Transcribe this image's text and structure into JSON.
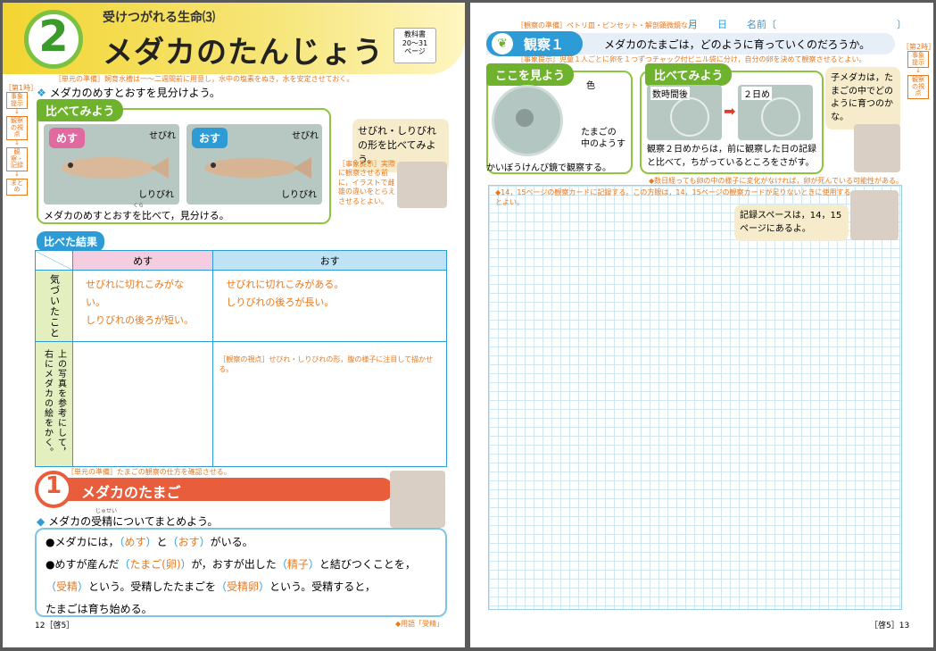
{
  "left": {
    "unit_number": "2",
    "unit_subtitle": "受けつがれる生命",
    "unit_subtitle_no": "⑶",
    "title": "メダカのたんじょう",
    "textbook_ref": "教科書\n20～31\nページ",
    "prep_note": "［単元の準備］飼育水槽は一～二週間前に用意し，水中の塩素をぬき，水を安定させておく。",
    "period_tag": "［第1時］",
    "side_steps": [
      "事象提示",
      "観察の視点",
      "観察・記録",
      "まとめ"
    ],
    "task": "メダカのめすとおすを見分けよう。",
    "compare_tag": "比べてみよう",
    "mesu": "めす",
    "osu": "おす",
    "sebire": "せびれ",
    "shiribire": "しりびれ",
    "compare_caption": "メダカのめすとおすを比べて，見分ける。",
    "caption_ruby": "くら",
    "bubble": "せびれ・しりびれの形を比べてみよう。",
    "event_note": "［事象提示］実際に観察させる前に，イラストで雌雄の違いをとらえさせるとよい。",
    "result_tag": "比べた結果",
    "table": {
      "col1": "めす",
      "col2": "おす",
      "row1_head": "気づいたこと",
      "row1_c1": "せびれに切れこみがない。\nしりびれの後ろが短い。",
      "row1_c2": "せびれに切れこみがある。\nしりびれの後ろが長い。",
      "row2_head": "上の写真を参考にして，右にメダカの絵をかく。",
      "row2_note": "［観察の視点］せびれ・しりびれの形，腹の様子に注目して描かせる。"
    },
    "sec1_prep": "［単元の準備］たまごの観察の仕方を確認させる。",
    "sec1_no": "1",
    "sec1_title": "メダカのたまご",
    "sec1_task": "メダカの受精についてまとめよう。",
    "sec1_ruby": "じゅせい",
    "sum": {
      "l1a": "●メダカには，",
      "l1_ans1": "めす",
      "l1b": "と",
      "l1_ans2": "おす",
      "l1c": "がいる。",
      "l2a": "●めすが産んだ",
      "l2_ans1": "たまご(卵)",
      "l2b": "が，おすが出した",
      "l2_ans2": "精子",
      "l2c": "と結びつくことを，",
      "l3_ans1": "受精",
      "l3b": "という。受精したたまごを",
      "l3_ans2": "受精卵",
      "l3c": "という。受精すると，",
      "l4": "たまごは育ち始める。"
    },
    "footer_page": "12［啓5］",
    "footer_term": "◆用語「受精」"
  },
  "right": {
    "prep_obs": "［観察の準備］ペトリ皿・ピンセット・解剖顕微鏡など",
    "date_line": "月　　日　　名前〔",
    "date_end": "〕",
    "obs_tag": "観察１",
    "obs_question": "メダカのたまごは，どのように育っていくのだろうか。",
    "event_note": "［事象提示］児童１人ごとに卵を１つずつチャック付ビニル袋に分け，自分の卵を決めて観察させるとよい。",
    "period_tag": "［第2時］",
    "side_steps": [
      "事象提示",
      "観察の視点"
    ],
    "look_tag": "ここを見よう",
    "label_color": "色",
    "label_inside": "たまごの\n中のようす",
    "look_caption": "かいぼうけんび鏡で観察する。",
    "compare_tag": "比べてみよう",
    "hours_label": "数時間後",
    "day2_label": "２日め",
    "compare_text": "観察２日めからは，前に観察した日の記録と比べて，ちがっているところをさがす。",
    "bubble": "子メダカは，たまごの中でどのように育つのかな。",
    "warn_note": "◆数日経っても卵の中の様子に変化がなければ，卵が死んでいる可能性がある。",
    "grid_note": "◆14，15ページの観察カードに記録する。この方眼は，14，15ページの観察カードが足りないときに使用するとよい。",
    "grid_bubble": "記録スペースは，14，15ページにあるよ。",
    "footer_page": "［啓5］13"
  }
}
